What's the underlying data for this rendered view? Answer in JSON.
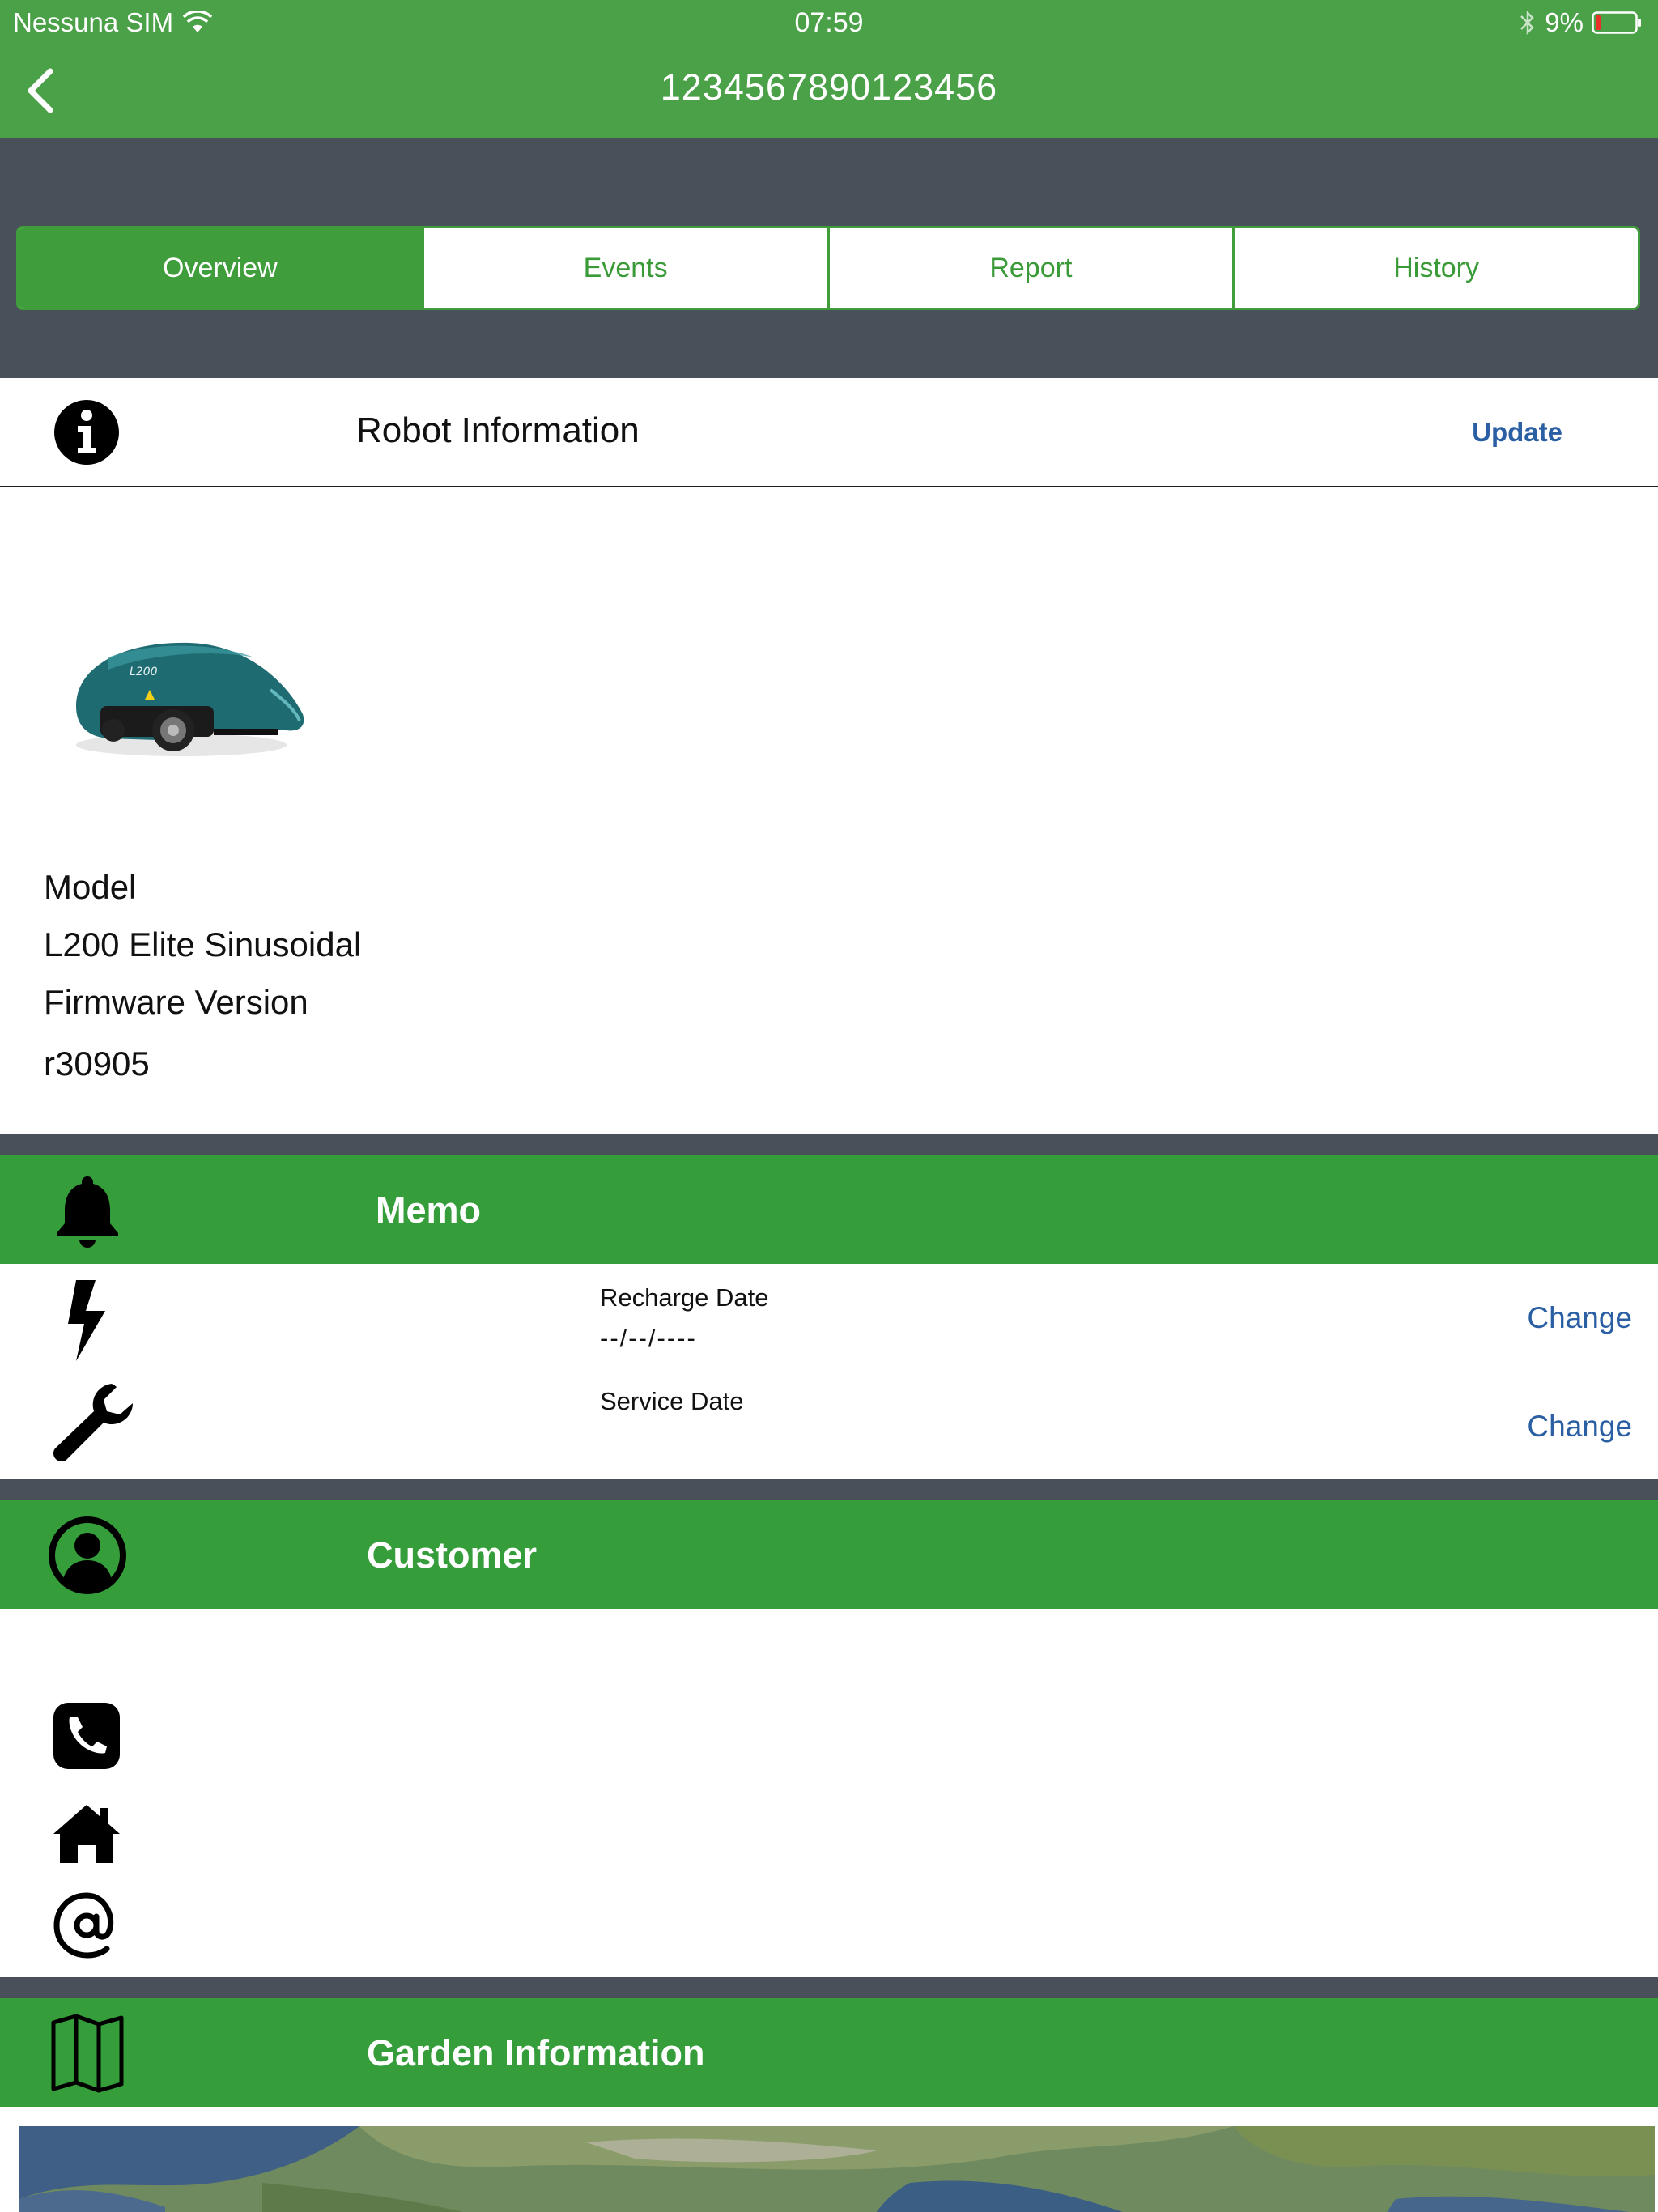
{
  "status_bar": {
    "carrier": "Nessuna SIM",
    "time": "07:59",
    "battery": "9%"
  },
  "nav": {
    "title": "1234567890123456"
  },
  "tabs": [
    {
      "label": "Overview",
      "active": true
    },
    {
      "label": "Events",
      "active": false
    },
    {
      "label": "Report",
      "active": false
    },
    {
      "label": "History",
      "active": false
    }
  ],
  "robot_info": {
    "title": "Robot Information",
    "update_label": "Update",
    "model_label": "Model",
    "model_value": "L200 Elite Sinusoidal",
    "firmware_label": "Firmware Version",
    "firmware_value": "r30905"
  },
  "memo": {
    "title": "Memo",
    "recharge_label": "Recharge Date",
    "recharge_value": "--/--/----",
    "service_label": "Service Date",
    "change_label": "Change"
  },
  "customer": {
    "title": "Customer"
  },
  "garden": {
    "title": "Garden Information"
  },
  "colors": {
    "nav_green": "#4aa148",
    "section_green": "#359d3a",
    "dark_band": "#4a5059",
    "link_blue": "#2b5fa4"
  },
  "icons": {
    "info": "info-icon",
    "bell": "bell-icon",
    "bolt": "lightning-bolt-icon",
    "wrench": "wrench-icon",
    "user": "user-circle-icon",
    "phone": "phone-icon",
    "home": "home-icon",
    "email": "at-sign-icon",
    "map": "map-icon"
  }
}
